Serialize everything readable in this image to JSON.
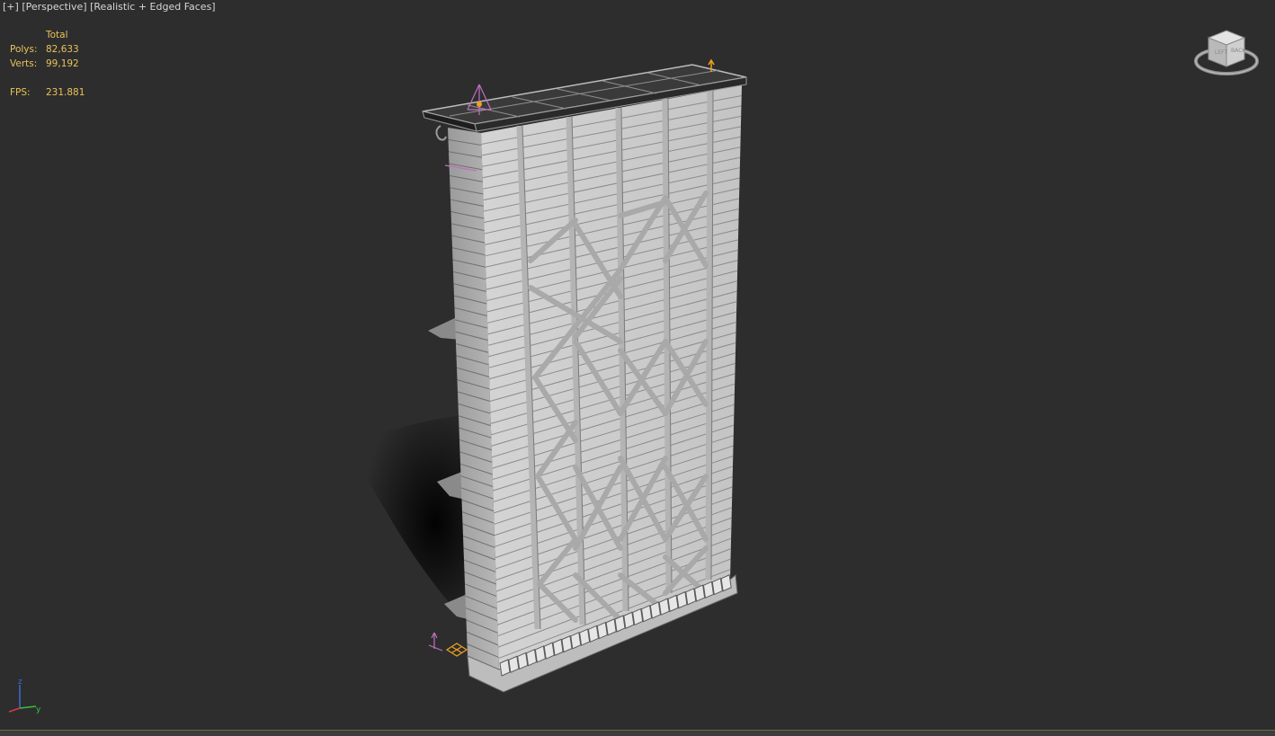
{
  "viewport": {
    "plus_label": "[+]",
    "view_label": "[Perspective]",
    "shading_label": "[Realistic + Edged Faces]"
  },
  "stats": {
    "header": "Total",
    "polys_label": "Polys:",
    "polys_value": "82,633",
    "verts_label": "Verts:",
    "verts_value": "99,192",
    "fps_label": "FPS:",
    "fps_value": "231.881"
  },
  "axis": {
    "z": "z",
    "y": "y"
  },
  "colors": {
    "viewport_bg": "#2d2d2d",
    "stats_text": "#e8c35a",
    "label_text": "#d6d6d6",
    "model_fill": "#c9c9c9",
    "helper_orange": "#f0a020",
    "helper_pink": "#c070c0"
  }
}
